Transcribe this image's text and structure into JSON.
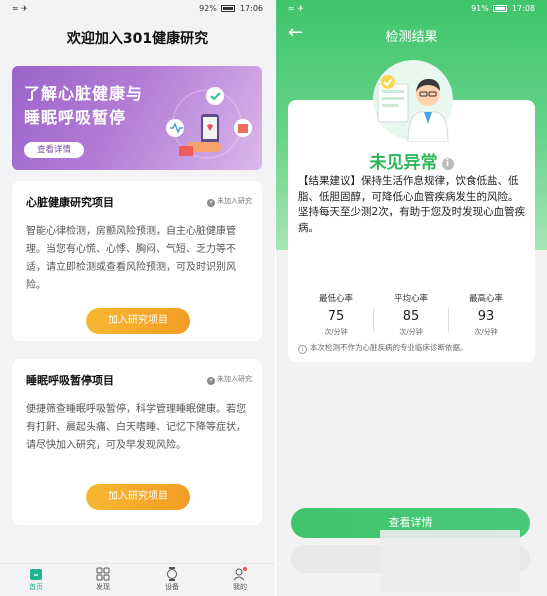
{
  "left": {
    "status": {
      "left": "≈ ✈",
      "battery": "92%",
      "time": "17:06"
    },
    "title": "欢迎加入301健康研究",
    "banner": {
      "line1": "了解心脏健康与",
      "line2": "睡眠呼吸暂停",
      "button": "查看详情",
      "bg_color": "#b57cd6"
    },
    "cards": [
      {
        "title": "心脏健康研究项目",
        "status": "未加入研究",
        "desc": "智能心律检测，房颤风险预测，自主心脏健康管理。当您有心慌、心悸、胸闷、气短、乏力等不适，请立即检测或查看风险预测，可及时识别风险。",
        "button": "加入研究项目"
      },
      {
        "title": "睡眠呼吸暂停项目",
        "status": "未加入研究",
        "desc": "便捷筛查睡眠呼吸暂停，科学管理睡眠健康。若您有打鼾、晨起头痛、白天嗜睡、记忆下降等症状，请尽快加入研究，可及早发现风险。",
        "button": "加入研究项目"
      }
    ],
    "tabs": [
      {
        "label": "首页",
        "icon": "home-icon",
        "active": true
      },
      {
        "label": "发现",
        "icon": "grid-icon",
        "active": false
      },
      {
        "label": "设备",
        "icon": "watch-icon",
        "active": false
      },
      {
        "label": "我的",
        "icon": "user-icon",
        "active": false
      }
    ],
    "accent_color": "#1fb58f",
    "button_color": "#f7b733"
  },
  "right": {
    "status": {
      "left": "≈ ✈",
      "battery": "91%",
      "time": "17:08"
    },
    "title": "检测结果",
    "result": "未见异常",
    "advice": "【结果建议】保持生活作息规律，饮食低盐、低脂、低胆固醇，可降低心血管疾病发生的风险。坚持每天至少测2次，有助于您及时发现心血管疾病。",
    "metrics": [
      {
        "label": "最低心率",
        "value": "75",
        "unit": "次/分钟"
      },
      {
        "label": "平均心率",
        "value": "85",
        "unit": "次/分钟"
      },
      {
        "label": "最高心率",
        "value": "93",
        "unit": "次/分钟"
      }
    ],
    "disclaimer": "本次检测不作为心脏疾病的专业临床诊断依据。",
    "button": "查看详情",
    "accent_color": "#3fc56b"
  }
}
